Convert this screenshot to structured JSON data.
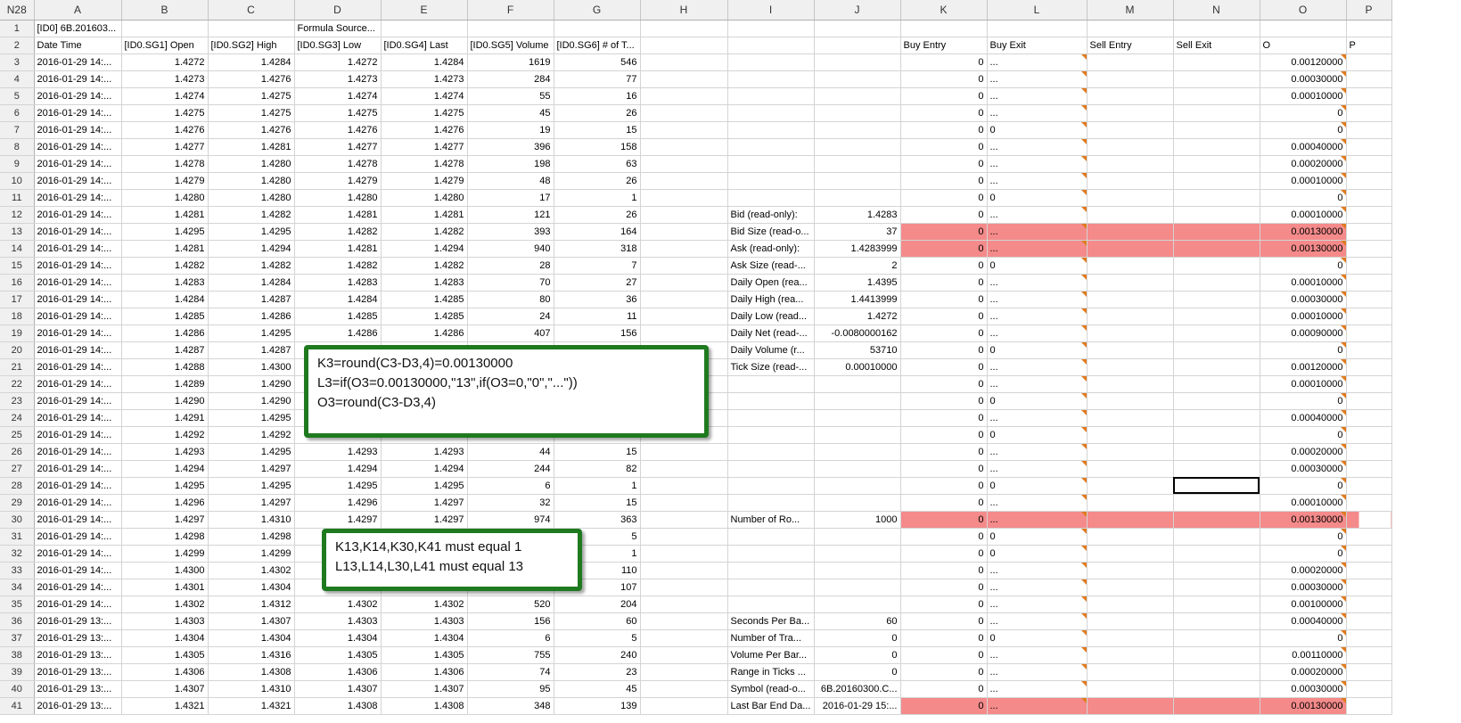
{
  "name_box": "N28",
  "columns": [
    "A",
    "B",
    "C",
    "D",
    "E",
    "F",
    "G",
    "H",
    "I",
    "J",
    "K",
    "L",
    "M",
    "N",
    "O",
    "P"
  ],
  "row1": {
    "A": "[ID0] 6B.201603...",
    "D": "Formula Source..."
  },
  "row2": {
    "A": "Date Time",
    "B": "[ID0.SG1] Open",
    "C": "[ID0.SG2] High",
    "D": "[ID0.SG3] Low",
    "E": "[ID0.SG4] Last",
    "F": "[ID0.SG5] Volume",
    "G": "[ID0.SG6] # of T...",
    "K": "Buy Entry",
    "L": "Buy Exit",
    "M": "Sell Entry",
    "N": "Sell Exit",
    "O": "O",
    "P": "P"
  },
  "rows": [
    {
      "n": "3",
      "A": "2016-01-29 14:...",
      "B": "1.4272",
      "C": "1.4284",
      "D": "1.4272",
      "E": "1.4284",
      "F": "1619",
      "G": "546",
      "I": "",
      "J": "",
      "K": "0",
      "L": "...",
      "O": "0.00120000"
    },
    {
      "n": "4",
      "A": "2016-01-29 14:...",
      "B": "1.4273",
      "C": "1.4276",
      "D": "1.4273",
      "E": "1.4273",
      "F": "284",
      "G": "77",
      "I": "",
      "J": "",
      "K": "0",
      "L": "...",
      "O": "0.00030000"
    },
    {
      "n": "5",
      "A": "2016-01-29 14:...",
      "B": "1.4274",
      "C": "1.4275",
      "D": "1.4274",
      "E": "1.4274",
      "F": "55",
      "G": "16",
      "I": "",
      "J": "",
      "K": "0",
      "L": "...",
      "O": "0.00010000"
    },
    {
      "n": "6",
      "A": "2016-01-29 14:...",
      "B": "1.4275",
      "C": "1.4275",
      "D": "1.4275",
      "E": "1.4275",
      "F": "45",
      "G": "26",
      "I": "",
      "J": "",
      "K": "0",
      "L": "...",
      "O": "0"
    },
    {
      "n": "7",
      "A": "2016-01-29 14:...",
      "B": "1.4276",
      "C": "1.4276",
      "D": "1.4276",
      "E": "1.4276",
      "F": "19",
      "G": "15",
      "I": "",
      "J": "",
      "K": "0",
      "L": "0",
      "O": "0"
    },
    {
      "n": "8",
      "A": "2016-01-29 14:...",
      "B": "1.4277",
      "C": "1.4281",
      "D": "1.4277",
      "E": "1.4277",
      "F": "396",
      "G": "158",
      "I": "",
      "J": "",
      "K": "0",
      "L": "...",
      "O": "0.00040000"
    },
    {
      "n": "9",
      "A": "2016-01-29 14:...",
      "B": "1.4278",
      "C": "1.4280",
      "D": "1.4278",
      "E": "1.4278",
      "F": "198",
      "G": "63",
      "I": "",
      "J": "",
      "K": "0",
      "L": "...",
      "O": "0.00020000"
    },
    {
      "n": "10",
      "A": "2016-01-29 14:...",
      "B": "1.4279",
      "C": "1.4280",
      "D": "1.4279",
      "E": "1.4279",
      "F": "48",
      "G": "26",
      "I": "",
      "J": "",
      "K": "0",
      "L": "...",
      "O": "0.00010000"
    },
    {
      "n": "11",
      "A": "2016-01-29 14:...",
      "B": "1.4280",
      "C": "1.4280",
      "D": "1.4280",
      "E": "1.4280",
      "F": "17",
      "G": "1",
      "I": "",
      "J": "",
      "K": "0",
      "L": "0",
      "O": "0"
    },
    {
      "n": "12",
      "A": "2016-01-29 14:...",
      "B": "1.4281",
      "C": "1.4282",
      "D": "1.4281",
      "E": "1.4281",
      "F": "121",
      "G": "26",
      "I": "Bid (read-only):",
      "J": "1.4283",
      "K": "0",
      "L": "...",
      "O": "0.00010000"
    },
    {
      "n": "13",
      "A": "2016-01-29 14:...",
      "B": "1.4295",
      "C": "1.4295",
      "D": "1.4282",
      "E": "1.4282",
      "F": "393",
      "G": "164",
      "I": "Bid Size (read-o...",
      "J": "37",
      "K": "0",
      "L": "...",
      "O": "0.00130000",
      "hl": true
    },
    {
      "n": "14",
      "A": "2016-01-29 14:...",
      "B": "1.4281",
      "C": "1.4294",
      "D": "1.4281",
      "E": "1.4294",
      "F": "940",
      "G": "318",
      "I": "Ask (read-only):",
      "J": "1.4283999",
      "K": "0",
      "L": "...",
      "O": "0.00130000",
      "hl": true
    },
    {
      "n": "15",
      "A": "2016-01-29 14:...",
      "B": "1.4282",
      "C": "1.4282",
      "D": "1.4282",
      "E": "1.4282",
      "F": "28",
      "G": "7",
      "I": "Ask Size (read-...",
      "J": "2",
      "K": "0",
      "L": "0",
      "O": "0"
    },
    {
      "n": "16",
      "A": "2016-01-29 14:...",
      "B": "1.4283",
      "C": "1.4284",
      "D": "1.4283",
      "E": "1.4283",
      "F": "70",
      "G": "27",
      "I": "Daily Open (rea...",
      "J": "1.4395",
      "K": "0",
      "L": "...",
      "O": "0.00010000"
    },
    {
      "n": "17",
      "A": "2016-01-29 14:...",
      "B": "1.4284",
      "C": "1.4287",
      "D": "1.4284",
      "E": "1.4285",
      "F": "80",
      "G": "36",
      "I": "Daily High (rea...",
      "J": "1.4413999",
      "K": "0",
      "L": "...",
      "O": "0.00030000"
    },
    {
      "n": "18",
      "A": "2016-01-29 14:...",
      "B": "1.4285",
      "C": "1.4286",
      "D": "1.4285",
      "E": "1.4285",
      "F": "24",
      "G": "11",
      "I": "Daily Low (read...",
      "J": "1.4272",
      "K": "0",
      "L": "...",
      "O": "0.00010000"
    },
    {
      "n": "19",
      "A": "2016-01-29 14:...",
      "B": "1.4286",
      "C": "1.4295",
      "D": "1.4286",
      "E": "1.4286",
      "F": "407",
      "G": "156",
      "I": "Daily Net (read-...",
      "J": "-0.0080000162",
      "K": "0",
      "L": "...",
      "O": "0.00090000"
    },
    {
      "n": "20",
      "A": "2016-01-29 14:...",
      "B": "1.4287",
      "C": "1.4287",
      "D": "",
      "E": "",
      "F": "",
      "G": "",
      "I": "Daily Volume (r...",
      "J": "53710",
      "K": "0",
      "L": "0",
      "O": "0"
    },
    {
      "n": "21",
      "A": "2016-01-29 14:...",
      "B": "1.4288",
      "C": "1.4300",
      "D": "",
      "E": "",
      "F": "",
      "G": "",
      "I": "Tick Size (read-...",
      "J": "0.00010000",
      "K": "0",
      "L": "...",
      "O": "0.00120000"
    },
    {
      "n": "22",
      "A": "2016-01-29 14:...",
      "B": "1.4289",
      "C": "1.4290",
      "D": "",
      "E": "",
      "F": "",
      "G": "",
      "I": "",
      "J": "",
      "K": "0",
      "L": "...",
      "O": "0.00010000"
    },
    {
      "n": "23",
      "A": "2016-01-29 14:...",
      "B": "1.4290",
      "C": "1.4290",
      "D": "",
      "E": "",
      "F": "",
      "G": "",
      "I": "",
      "J": "",
      "K": "0",
      "L": "0",
      "O": "0"
    },
    {
      "n": "24",
      "A": "2016-01-29 14:...",
      "B": "1.4291",
      "C": "1.4295",
      "D": "",
      "E": "",
      "F": "",
      "G": "",
      "I": "",
      "J": "",
      "K": "0",
      "L": "...",
      "O": "0.00040000"
    },
    {
      "n": "25",
      "A": "2016-01-29 14:...",
      "B": "1.4292",
      "C": "1.4292",
      "D": "",
      "E": "",
      "F": "",
      "G": "",
      "I": "",
      "J": "",
      "K": "0",
      "L": "0",
      "O": "0"
    },
    {
      "n": "26",
      "A": "2016-01-29 14:...",
      "B": "1.4293",
      "C": "1.4295",
      "D": "1.4293",
      "E": "1.4293",
      "F": "44",
      "G": "15",
      "I": "",
      "J": "",
      "K": "0",
      "L": "...",
      "O": "0.00020000"
    },
    {
      "n": "27",
      "A": "2016-01-29 14:...",
      "B": "1.4294",
      "C": "1.4297",
      "D": "1.4294",
      "E": "1.4294",
      "F": "244",
      "G": "82",
      "I": "",
      "J": "",
      "K": "0",
      "L": "...",
      "O": "0.00030000"
    },
    {
      "n": "28",
      "A": "2016-01-29 14:...",
      "B": "1.4295",
      "C": "1.4295",
      "D": "1.4295",
      "E": "1.4295",
      "F": "6",
      "G": "1",
      "I": "",
      "J": "",
      "K": "0",
      "L": "0",
      "O": "0",
      "sel": true
    },
    {
      "n": "29",
      "A": "2016-01-29 14:...",
      "B": "1.4296",
      "C": "1.4297",
      "D": "1.4296",
      "E": "1.4297",
      "F": "32",
      "G": "15",
      "I": "",
      "J": "",
      "K": "0",
      "L": "...",
      "O": "0.00010000"
    },
    {
      "n": "30",
      "A": "2016-01-29 14:...",
      "B": "1.4297",
      "C": "1.4310",
      "D": "1.4297",
      "E": "1.4297",
      "F": "974",
      "G": "363",
      "I": "Number of Ro...",
      "J": "1000",
      "K": "0",
      "L": "...",
      "O": "0.00130000",
      "hl": true
    },
    {
      "n": "31",
      "A": "2016-01-29 14:...",
      "B": "1.4298",
      "C": "1.4298",
      "D": "",
      "E": "",
      "F": "",
      "G": "5",
      "I": "",
      "J": "",
      "K": "0",
      "L": "0",
      "O": "0"
    },
    {
      "n": "32",
      "A": "2016-01-29 14:...",
      "B": "1.4299",
      "C": "1.4299",
      "D": "",
      "E": "",
      "F": "",
      "G": "1",
      "I": "",
      "J": "",
      "K": "0",
      "L": "0",
      "O": "0"
    },
    {
      "n": "33",
      "A": "2016-01-29 14:...",
      "B": "1.4300",
      "C": "1.4302",
      "D": "",
      "E": "",
      "F": "",
      "G": "110",
      "I": "",
      "J": "",
      "K": "0",
      "L": "...",
      "O": "0.00020000"
    },
    {
      "n": "34",
      "A": "2016-01-29 14:...",
      "B": "1.4301",
      "C": "1.4304",
      "D": "",
      "E": "",
      "F": "",
      "G": "107",
      "I": "",
      "J": "",
      "K": "0",
      "L": "...",
      "O": "0.00030000"
    },
    {
      "n": "35",
      "A": "2016-01-29 14:...",
      "B": "1.4302",
      "C": "1.4312",
      "D": "1.4302",
      "E": "1.4302",
      "F": "520",
      "G": "204",
      "I": "",
      "J": "",
      "K": "0",
      "L": "...",
      "O": "0.00100000"
    },
    {
      "n": "36",
      "A": "2016-01-29 13:...",
      "B": "1.4303",
      "C": "1.4307",
      "D": "1.4303",
      "E": "1.4303",
      "F": "156",
      "G": "60",
      "I": "Seconds Per Ba...",
      "J": "60",
      "K": "0",
      "L": "...",
      "O": "0.00040000"
    },
    {
      "n": "37",
      "A": "2016-01-29 13:...",
      "B": "1.4304",
      "C": "1.4304",
      "D": "1.4304",
      "E": "1.4304",
      "F": "6",
      "G": "5",
      "I": "Number of Tra...",
      "J": "0",
      "K": "0",
      "L": "0",
      "O": "0"
    },
    {
      "n": "38",
      "A": "2016-01-29 13:...",
      "B": "1.4305",
      "C": "1.4316",
      "D": "1.4305",
      "E": "1.4305",
      "F": "755",
      "G": "240",
      "I": "Volume Per Bar...",
      "J": "0",
      "K": "0",
      "L": "...",
      "O": "0.00110000"
    },
    {
      "n": "39",
      "A": "2016-01-29 13:...",
      "B": "1.4306",
      "C": "1.4308",
      "D": "1.4306",
      "E": "1.4306",
      "F": "74",
      "G": "23",
      "I": "Range in Ticks ...",
      "J": "0",
      "K": "0",
      "L": "...",
      "O": "0.00020000"
    },
    {
      "n": "40",
      "A": "2016-01-29 13:...",
      "B": "1.4307",
      "C": "1.4310",
      "D": "1.4307",
      "E": "1.4307",
      "F": "95",
      "G": "45",
      "I": "Symbol (read-o...",
      "J": "6B.20160300.C...",
      "K": "0",
      "L": "...",
      "O": "0.00030000"
    },
    {
      "n": "41",
      "A": "2016-01-29 13:...",
      "B": "1.4321",
      "C": "1.4321",
      "D": "1.4308",
      "E": "1.4308",
      "F": "348",
      "G": "139",
      "I": "Last Bar End Da...",
      "J": "2016-01-29 15:...",
      "K": "0",
      "L": "...",
      "O": "0.00130000",
      "hl": true
    }
  ],
  "callout_formulas": {
    "line1": "K3=round(C3-D3,4)=0.00130000",
    "line2": "L3=if(O3=0.00130000,\"13\",if(O3=0,\"0\",\"...\"))",
    "line3": "O3=round(C3-D3,4)"
  },
  "callout_requirements": {
    "line1": "K13,K14,K30,K41 must equal 1",
    "line2": "L13,L14,L30,L41 must equal 13"
  },
  "colors": {
    "highlight": "#f48a8a",
    "callout_border": "#1f7a1f",
    "comment_marker": "#e07a1f"
  }
}
